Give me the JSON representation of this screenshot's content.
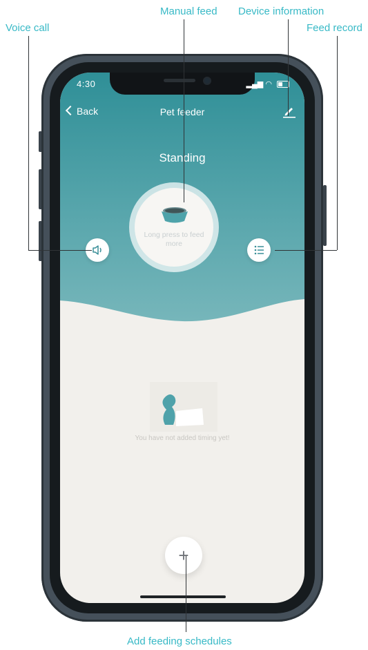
{
  "callouts": {
    "manual_feed": "Manual feed",
    "device_info": "Device information",
    "voice_call": "Voice call",
    "feed_record": "Feed record",
    "add_schedules": "Add feeding schedules"
  },
  "status_bar": {
    "time": "4:30"
  },
  "nav": {
    "back_label": "Back",
    "title": "Pet feeder"
  },
  "device": {
    "status": "Standing"
  },
  "manual_feed": {
    "label": "Long press to feed more"
  },
  "empty_state": {
    "text": "You have not added timing yet!"
  },
  "add_button": {
    "symbol": "+"
  },
  "icons": {
    "edit": "pencil-icon",
    "voice": "speaker-icon",
    "record": "list-icon",
    "bowl": "food-bowl-icon"
  },
  "colors": {
    "accent": "#37b9c6",
    "header": "#4c9ea5",
    "background": "#f2f0ec"
  }
}
